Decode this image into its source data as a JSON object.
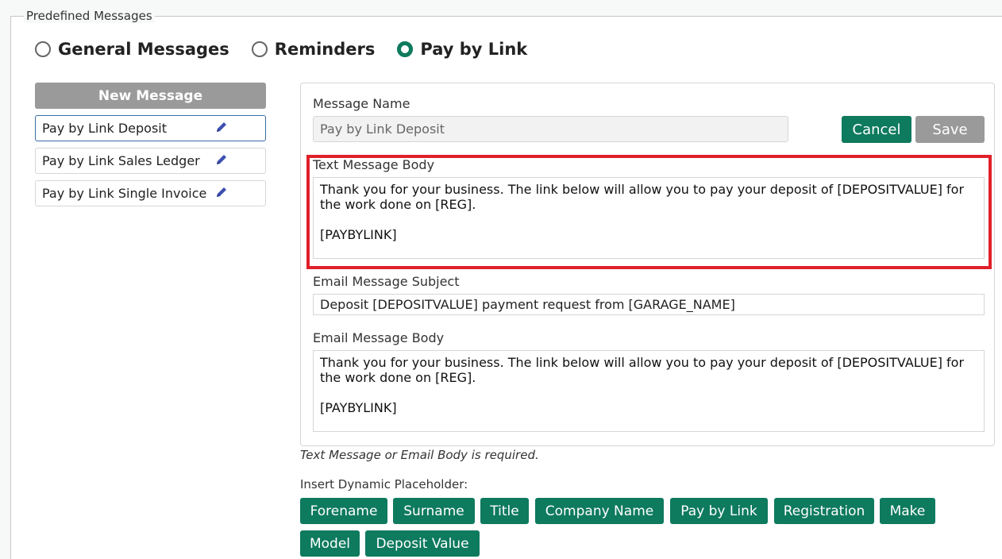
{
  "legend": "Predefined Messages",
  "radios": [
    {
      "label": "General Messages",
      "checked": false
    },
    {
      "label": "Reminders",
      "checked": false
    },
    {
      "label": "Pay by Link",
      "checked": true
    }
  ],
  "sidebar": {
    "new_message_label": "New Message",
    "items": [
      {
        "label": "Pay by Link Deposit",
        "icon": "pencil-icon"
      },
      {
        "label": "Pay by Link Sales Ledger",
        "icon": "pencil-icon"
      },
      {
        "label": "Pay by Link Single Invoice",
        "icon": "pencil-icon"
      }
    ]
  },
  "form": {
    "message_name_label": "Message Name",
    "message_name_placeholder": "Pay by Link Deposit",
    "cancel_label": "Cancel",
    "save_label": "Save",
    "text_body_label": "Text Message Body",
    "text_body_value": "Thank you for your business. The link below will allow you to pay your deposit of [DEPOSITVALUE] for the work done on [REG].\n\n[PAYBYLINK]",
    "email_subject_label": "Email Message Subject",
    "email_subject_value": "Deposit [DEPOSITVALUE] payment request from [GARAGE_NAME]",
    "email_body_label": "Email Message Body",
    "email_body_value": "Thank you for your business. The link below will allow you to pay your deposit of [DEPOSITVALUE] for the work done on [REG].\n\n[PAYBYLINK]"
  },
  "required_note": "Text Message or Email Body is required.",
  "placeholders": {
    "label": "Insert Dynamic Placeholder:",
    "chips": [
      "Forename",
      "Surname",
      "Title",
      "Company Name",
      "Pay by Link",
      "Registration",
      "Make",
      "Model",
      "Deposit Value"
    ]
  },
  "colors": {
    "accent": "#0e7a5e",
    "highlight": "#e0202a",
    "disabled": "#9a9a9a"
  }
}
